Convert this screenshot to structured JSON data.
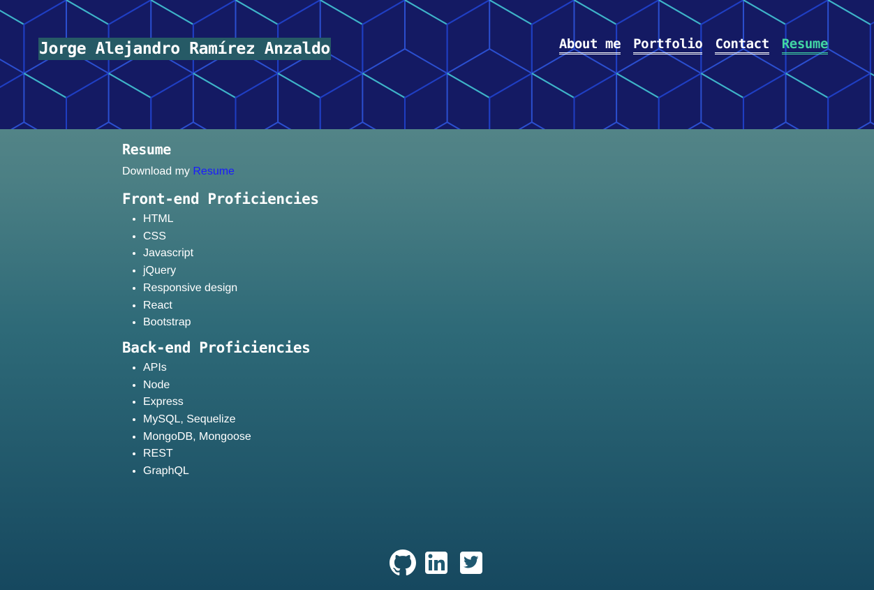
{
  "header": {
    "site_title": "Jorge Alejandro Ramírez Anzaldo",
    "nav": [
      {
        "label": "About me",
        "active": false
      },
      {
        "label": "Portfolio",
        "active": false
      },
      {
        "label": "Contact",
        "active": false
      },
      {
        "label": "Resume",
        "active": true
      }
    ]
  },
  "main": {
    "title": "Resume",
    "download_prefix": "Download my ",
    "download_link": "Resume",
    "frontend": {
      "heading": "Front-end Proficiencies",
      "items": [
        "HTML",
        "CSS",
        "Javascript",
        "jQuery",
        "Responsive design",
        "React",
        "Bootstrap"
      ]
    },
    "backend": {
      "heading": "Back-end Proficiencies",
      "items": [
        "APIs",
        "Node",
        "Express",
        "MySQL, Sequelize",
        "MongoDB, Mongoose",
        "REST",
        "GraphQL"
      ]
    }
  },
  "footer": {
    "icons": [
      "github-icon",
      "linkedin-icon",
      "twitter-icon"
    ]
  },
  "colors": {
    "header_bg": "#141a63",
    "active_nav": "#42d6a4",
    "link_blue": "#1a1aff"
  }
}
